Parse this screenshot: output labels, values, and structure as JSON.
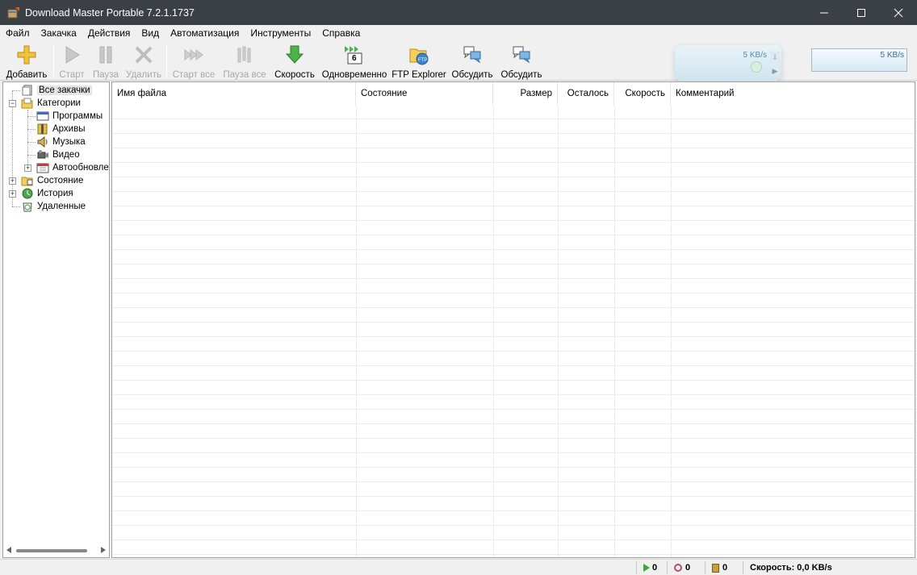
{
  "window": {
    "title": "Download Master Portable 7.2.1.1737"
  },
  "menu": [
    "Файл",
    "Закачка",
    "Действия",
    "Вид",
    "Автоматизация",
    "Инструменты",
    "Справка"
  ],
  "toolbar": {
    "add": "Добавить",
    "start": "Старт",
    "pause": "Пауза",
    "delete": "Удалить",
    "start_all": "Старт все",
    "pause_all": "Пауза все",
    "speed": "Скорость",
    "simultaneous": "Одновременно",
    "simultaneous_badge": "6",
    "ftp": "FTP Explorer",
    "discuss1": "Обсудить",
    "discuss2": "Обсудить",
    "speed_widget_value": "5 KB/s",
    "speed_limit_value": "5 KB/s"
  },
  "tree": {
    "all": "Все закачки",
    "categories": "Категории",
    "programs": "Программы",
    "archives": "Архивы",
    "music": "Музыка",
    "video": "Видео",
    "autoupdate": "Автообновле",
    "state": "Состояние",
    "history": "История",
    "deleted": "Удаленные"
  },
  "columns": [
    "Имя файла",
    "Состояние",
    "Размер",
    "Осталось",
    "Скорость",
    "Комментарий"
  ],
  "status": {
    "active": "0",
    "paused": "0",
    "completed": "0",
    "speed": "Скорость: 0,0 KB/s"
  }
}
